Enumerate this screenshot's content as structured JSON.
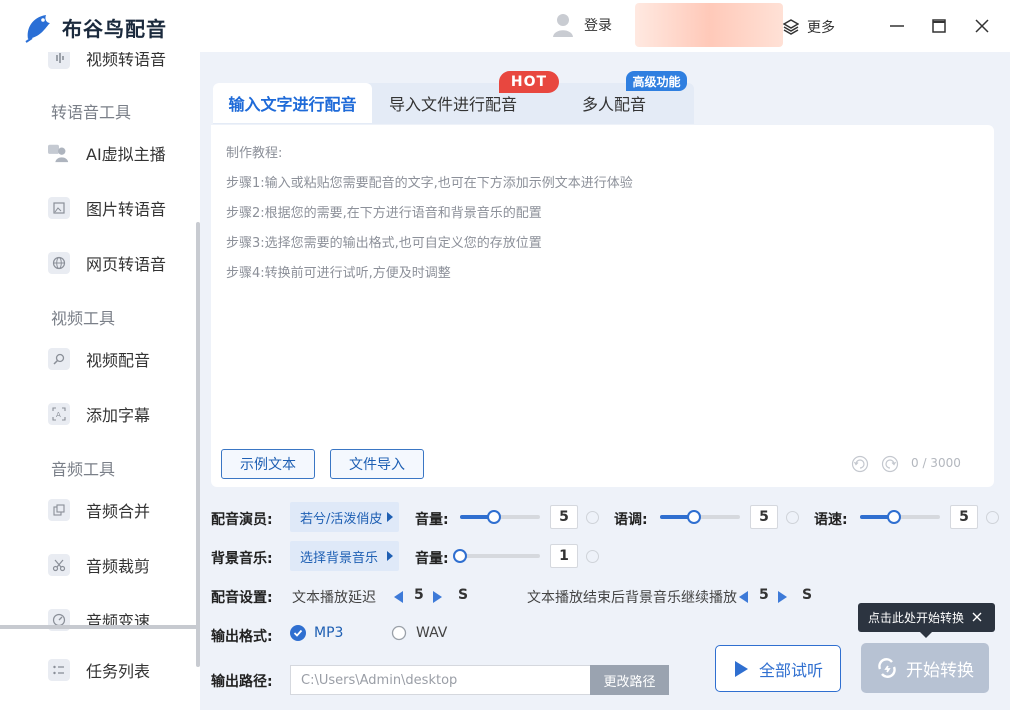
{
  "app": {
    "name": "布谷鸟配音"
  },
  "titlebar": {
    "login_label": "登录",
    "more_label": "更多"
  },
  "sidebar": {
    "top_partial_item": "视频转语音",
    "sections": [
      {
        "heading": "转语音工具",
        "items": [
          "AI虚拟主播",
          "图片转语音",
          "网页转语音"
        ]
      },
      {
        "heading": "视频工具",
        "items": [
          "视频配音",
          "添加字幕"
        ]
      },
      {
        "heading": "音频工具",
        "items": [
          "音频合并",
          "音频裁剪",
          "音频变速"
        ]
      }
    ],
    "bottom_item": "任务列表"
  },
  "tabs": [
    {
      "label": "输入文字进行配音",
      "active": true
    },
    {
      "label": "导入文件进行配音",
      "badge": "HOT"
    },
    {
      "label": "多人配音",
      "badge": "高级功能"
    }
  ],
  "editor": {
    "hints": [
      "制作教程:",
      "步骤1:输入或粘贴您需要配音的文字,也可在下方添加示例文本进行体验",
      "步骤2:根据您的需要,在下方进行语音和背景音乐的配置",
      "步骤3:选择您需要的输出格式,也可自定义您的存放位置",
      "步骤4:转换前可进行试听,方便及时调整"
    ],
    "sample_button": "示例文本",
    "import_button": "文件导入",
    "char_count": "0 / 3000"
  },
  "settings": {
    "voice_label": "配音演员:",
    "voice_value": "若兮/活泼俏皮",
    "volume_label": "音量:",
    "volume_value": "5",
    "pitch_label": "语调:",
    "pitch_value": "5",
    "speed_label": "语速:",
    "speed_value": "5",
    "bgm_label": "背景音乐:",
    "bgm_value": "选择背景音乐",
    "bgm_volume_label": "音量:",
    "bgm_volume_value": "1",
    "config_label": "配音设置:",
    "delay_label": "文本播放延迟",
    "delay_value": "5",
    "delay_unit": "S",
    "continue_label": "文本播放结束后背景音乐继续播放",
    "continue_value": "5",
    "continue_unit": "S",
    "format_label": "输出格式:",
    "format_options": [
      "MP3",
      "WAV"
    ],
    "format_selected": "MP3",
    "path_label": "输出路径:",
    "path_value": "C:\\Users\\Admin\\desktop",
    "change_path_button": "更改路径"
  },
  "slider_levels": {
    "volume": 0.42,
    "pitch": 0.42,
    "speed": 0.42,
    "bgm_volume": 0.0
  },
  "actions": {
    "preview_button": "全部试听",
    "start_button": "开始转换",
    "tooltip": "点击此处开始转换"
  },
  "colors": {
    "accent": "#1e6ad8",
    "hot_badge": "#e8473f",
    "pro_badge": "#2f7fe0",
    "tooltip_bg": "#2c3440"
  }
}
